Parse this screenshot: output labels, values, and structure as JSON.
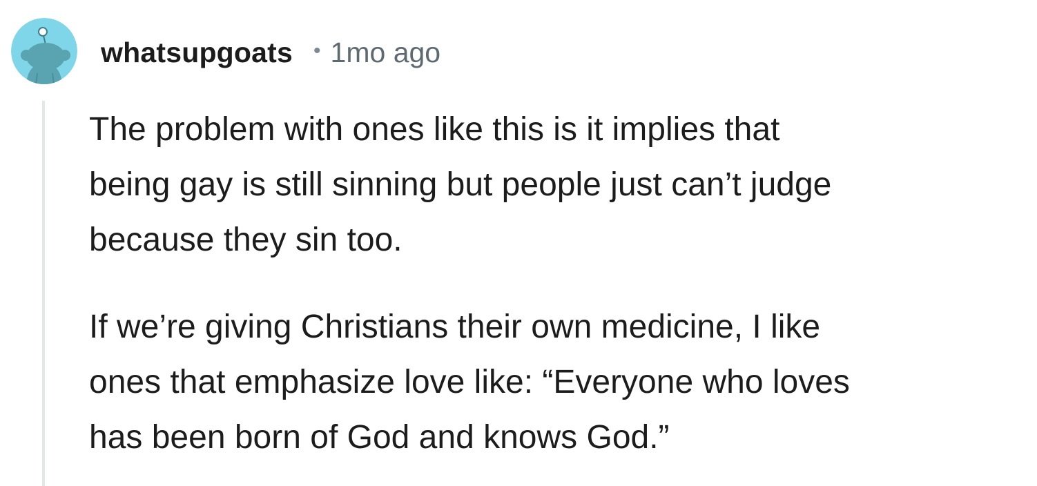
{
  "comment": {
    "username": "whatsupgoats",
    "separator": "•",
    "timestamp": "1mo ago",
    "paragraphs": [
      {
        "lines": [
          "The problem with ones like this is it implies that",
          "being gay is still sinning but people just can’t judge",
          "because they sin too."
        ]
      },
      {
        "lines": [
          "If we’re giving Christians their own medicine, I like",
          "ones that emphasize love like: “Everyone who loves",
          "has been born of God and knows God.”"
        ]
      }
    ]
  },
  "colors": {
    "avatar_bg": "#7fd6e8",
    "avatar_figure": "#5aa3b1",
    "thread_line": "#e4e6e8",
    "text": "#1c1c1c",
    "meta": "#5e6a72"
  },
  "icons": {
    "avatar": "reddit-snoo-avatar-icon"
  }
}
